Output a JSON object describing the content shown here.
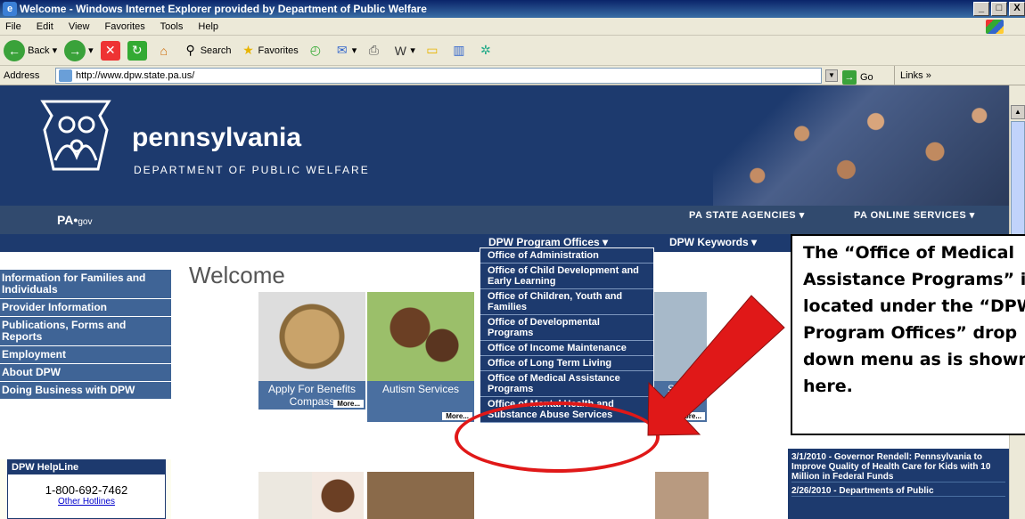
{
  "window": {
    "title": "Welcome - Windows Internet Explorer provided by Department of Public Welfare",
    "controls": [
      "_",
      "□",
      "X"
    ]
  },
  "menu": [
    "File",
    "Edit",
    "View",
    "Favorites",
    "Tools",
    "Help"
  ],
  "toolbar": {
    "back": "Back",
    "search": "Search",
    "favorites": "Favorites"
  },
  "address": {
    "label": "Address",
    "url": "http://www.dpw.state.pa.us/",
    "go": "Go",
    "links": "Links"
  },
  "header": {
    "brand": "pennsylvania",
    "dept": "DEPARTMENT OF PUBLIC WELFARE"
  },
  "pagov": {
    "pa": "PA",
    "gov": "gov",
    "agencies": "PA STATE AGENCIES ▾",
    "online": "PA ONLINE SERVICES ▾"
  },
  "nav": {
    "program_offices": "DPW Program Offices ▾",
    "keywords": "DPW Keywords ▾"
  },
  "sidebar": [
    "Information for Families and Individuals",
    "Provider Information",
    "Publications, Forms and Reports",
    "Employment",
    "About DPW",
    "Doing Business with DPW"
  ],
  "helpline": {
    "title": "DPW HelpLine",
    "number": "1-800-692-7462",
    "link": "Other Hotlines"
  },
  "welcome": "Welcome",
  "tiles": {
    "apply": {
      "caption": "Apply For Benefits Compass",
      "more": "More..."
    },
    "autism": {
      "caption": "Autism Services",
      "more": "More..."
    },
    "state": {
      "caption": "State",
      "more": "More..."
    }
  },
  "dropdown": [
    "Office of Administration",
    "Office of Child Development and Early Learning",
    "Office of Children, Youth and Families",
    "Office of Developmental Programs",
    "Office of Income Maintenance",
    "Office of Long Term Living",
    "Office of Medical Assistance Programs",
    "Office of Mental Health and Substance Abuse Services"
  ],
  "news": [
    "3/1/2010 - Governor Rendell: Pennsylvania to Improve Quality of Health Care for Kids with 10 Million in Federal Funds",
    "2/26/2010 - Departments of Public"
  ],
  "callout": "The “Office of Medical Assistance Programs” is located under the “DPW Program Offices” drop down menu as is shown here.",
  "colors": {
    "header": "#1d3a6e",
    "sidebar": "#3f6496",
    "highlight": "#e01818"
  }
}
